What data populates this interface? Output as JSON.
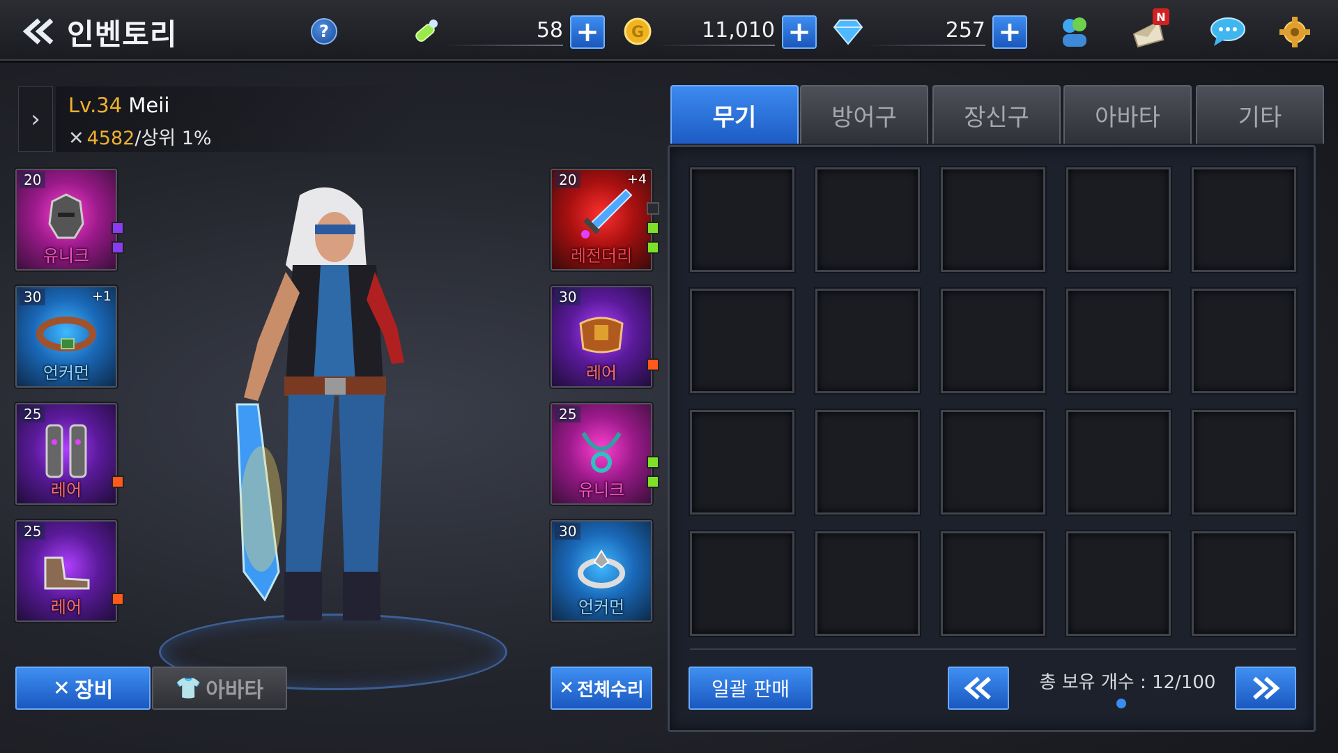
{
  "header": {
    "back_icon": "double-chevron-left-icon",
    "title": "인벤토리",
    "help_label": "?",
    "stamina": "58",
    "gold": "11,010",
    "gems": "257",
    "plus_label": "+",
    "notification_badge": "N"
  },
  "character": {
    "expand_icon": "chevron-right-icon",
    "level_prefix": "Lv.34",
    "name": "Meii",
    "power": "4582",
    "rank": "/상위 1%"
  },
  "equipment_left": [
    {
      "level": "20",
      "enhance": "",
      "rarity": "유니크",
      "gems": [
        "violet",
        "violet"
      ]
    },
    {
      "level": "30",
      "enhance": "+1",
      "rarity": "언커먼",
      "gems": []
    },
    {
      "level": "25",
      "enhance": "",
      "rarity": "레어",
      "gems": [
        "orange"
      ]
    },
    {
      "level": "25",
      "enhance": "",
      "rarity": "레어",
      "gems": [
        "orange"
      ]
    }
  ],
  "equipment_right": [
    {
      "level": "20",
      "enhance": "+4",
      "rarity": "레전더리",
      "gems": [
        "empty",
        "green",
        "green"
      ]
    },
    {
      "level": "30",
      "enhance": "",
      "rarity": "레어",
      "gems": [
        "orange"
      ]
    },
    {
      "level": "25",
      "enhance": "",
      "rarity": "유니크",
      "gems": [
        "green",
        "green"
      ]
    },
    {
      "level": "30",
      "enhance": "",
      "rarity": "언커먼",
      "gems": []
    }
  ],
  "bottom_left": {
    "equip_tab": "장비",
    "avatar_tab": "아바타",
    "repair_all": "전체수리"
  },
  "inventory": {
    "tabs": [
      "무기",
      "방어구",
      "장신구",
      "아바타",
      "기타"
    ],
    "active_tab": "무기",
    "bulk_sell": "일괄 판매",
    "count_label": "총 보유 개수 : 12/100"
  },
  "colors": {
    "accent_blue": "#2a74dc",
    "gold_text": "#f0b030",
    "unique_pink": "#ff4fc8",
    "rare_red": "#ff6c6c"
  }
}
